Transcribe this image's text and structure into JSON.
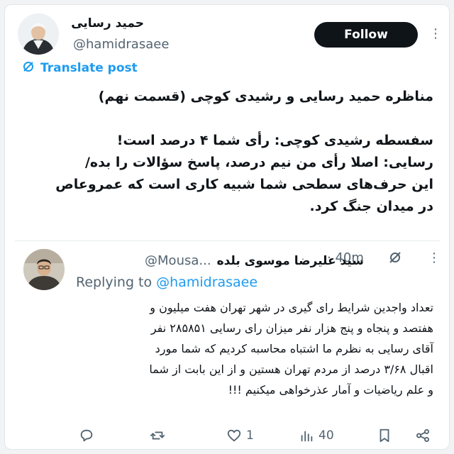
{
  "author": {
    "name": "حمید رسایی",
    "handle": "@hamidrasaee"
  },
  "follow_label": "Follow",
  "translate_label": "Translate post",
  "tweet": {
    "lines": [
      "مناظره حمید رسایی و رشیدی کوچی (قسمت نهم)",
      "",
      "سفسطه رشیدی کوچی: رأی شما ۴ درصد است!",
      "رسایی: اصلا رأی من نیم درصد، پاسخ سؤالات را بده/",
      "این حرف‌های سطحی شما شبیه کاری است که عمروعاص",
      "در میدان جنگ کرد."
    ]
  },
  "reply": {
    "name": "سید علیرضا موسوی بلده",
    "handle": "@Mousa...",
    "time": "· 40m",
    "replying_prefix": "Replying to ",
    "replying_to": "@hamidrasaee",
    "lines": [
      "تعداد واجدین شرایط رای گیری در شهر تهران هفت میلیون و",
      "هفتصد و پنجاه و پنج هزار نفر میزان رای رسایی ۲۸۵۸۵۱ نفر",
      "آقای رسایی به نظرم ما اشتباه محاسبه کردیم که شما مورد",
      "اقبال ۳/۶۸ درصد از مردم تهران هستین و از این بابت از شما",
      "و علم ریاضیات و آمار عذرخواهی میکنیم !!!"
    ],
    "actions": {
      "reply_count": "",
      "retweet_count": "",
      "like_count": "1",
      "views_count": "40"
    }
  },
  "icons": [
    "grok-icon",
    "more-icon",
    "reply-icon",
    "retweet-icon",
    "like-icon",
    "views-icon",
    "bookmark-icon",
    "share-icon"
  ]
}
